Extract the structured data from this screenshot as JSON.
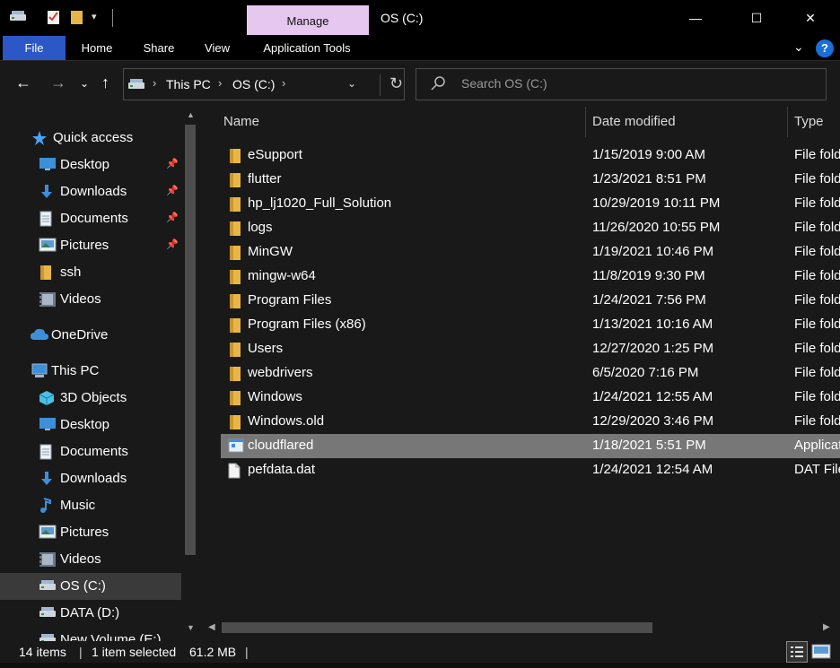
{
  "titlebar": {
    "contextual_tab": "Manage",
    "title": "OS (C:)",
    "minimize": "—",
    "maximize": "☐",
    "close": "✕"
  },
  "ribbon": {
    "tabs": [
      "File",
      "Home",
      "Share",
      "View",
      "Application Tools"
    ],
    "help": "?"
  },
  "address": {
    "crumbs": [
      "This PC",
      "OS (C:)"
    ]
  },
  "search": {
    "placeholder": "Search OS (C:)"
  },
  "navpane": {
    "items": [
      {
        "label": "Quick access",
        "icon": "star-icon",
        "pinned": false
      },
      {
        "label": "Desktop",
        "icon": "desktop-icon",
        "pinned": true
      },
      {
        "label": "Downloads",
        "icon": "download-arrow-icon",
        "pinned": true
      },
      {
        "label": "Documents",
        "icon": "document-icon",
        "pinned": true
      },
      {
        "label": "Pictures",
        "icon": "picture-icon",
        "pinned": true
      },
      {
        "label": "ssh",
        "icon": "folder-icon",
        "pinned": false
      },
      {
        "label": "Videos",
        "icon": "video-icon",
        "pinned": false
      },
      {
        "label": "OneDrive",
        "icon": "cloud-icon",
        "pinned": false
      },
      {
        "label": "This PC",
        "icon": "computer-icon",
        "pinned": false
      },
      {
        "label": "3D Objects",
        "icon": "cube-icon",
        "pinned": false
      },
      {
        "label": "Desktop",
        "icon": "desktop-icon",
        "pinned": false
      },
      {
        "label": "Documents",
        "icon": "document-icon",
        "pinned": false
      },
      {
        "label": "Downloads",
        "icon": "download-arrow-icon",
        "pinned": false
      },
      {
        "label": "Music",
        "icon": "music-note-icon",
        "pinned": false
      },
      {
        "label": "Pictures",
        "icon": "picture-icon",
        "pinned": false
      },
      {
        "label": "Videos",
        "icon": "video-icon",
        "pinned": false
      },
      {
        "label": "OS (C:)",
        "icon": "drive-icon",
        "pinned": false,
        "selected": true
      },
      {
        "label": "DATA (D:)",
        "icon": "drive-icon",
        "pinned": false
      },
      {
        "label": "New Volume (E:)",
        "icon": "drive-icon",
        "pinned": false
      }
    ]
  },
  "columns": {
    "name": "Name",
    "date": "Date modified",
    "type": "Type"
  },
  "files": [
    {
      "name": "eSupport",
      "date": "1/15/2019 9:00 AM",
      "type": "File folder",
      "icon": "folder-icon"
    },
    {
      "name": "flutter",
      "date": "1/23/2021 8:51 PM",
      "type": "File folder",
      "icon": "folder-icon"
    },
    {
      "name": "hp_lj1020_Full_Solution",
      "date": "10/29/2019 10:11 PM",
      "type": "File folder",
      "icon": "folder-icon"
    },
    {
      "name": "logs",
      "date": "11/26/2020 10:55 PM",
      "type": "File folder",
      "icon": "folder-icon"
    },
    {
      "name": "MinGW",
      "date": "1/19/2021 10:46 PM",
      "type": "File folder",
      "icon": "folder-icon"
    },
    {
      "name": "mingw-w64",
      "date": "11/8/2019 9:30 PM",
      "type": "File folder",
      "icon": "folder-icon"
    },
    {
      "name": "Program Files",
      "date": "1/24/2021 7:56 PM",
      "type": "File folder",
      "icon": "folder-icon"
    },
    {
      "name": "Program Files (x86)",
      "date": "1/13/2021 10:16 AM",
      "type": "File folder",
      "icon": "folder-icon"
    },
    {
      "name": "Users",
      "date": "12/27/2020 1:25 PM",
      "type": "File folder",
      "icon": "folder-icon"
    },
    {
      "name": "webdrivers",
      "date": "6/5/2020 7:16 PM",
      "type": "File folder",
      "icon": "folder-icon"
    },
    {
      "name": "Windows",
      "date": "1/24/2021 12:55 AM",
      "type": "File folder",
      "icon": "folder-icon"
    },
    {
      "name": "Windows.old",
      "date": "12/29/2020 3:46 PM",
      "type": "File folder",
      "icon": "folder-icon"
    },
    {
      "name": "cloudflared",
      "date": "1/18/2021 5:51 PM",
      "type": "Application",
      "icon": "application-icon",
      "selected": true
    },
    {
      "name": "pefdata.dat",
      "date": "1/24/2021 12:54 AM",
      "type": "DAT File",
      "icon": "file-icon"
    }
  ],
  "status": {
    "count": "14 items",
    "selected": "1 item selected",
    "size": "61.2 MB"
  },
  "colors": {
    "file_tab": "#2b57c7",
    "manage_tab": "#e6c7f0",
    "background": "#191919",
    "selection": "#777777",
    "folder": "#e8b646"
  }
}
